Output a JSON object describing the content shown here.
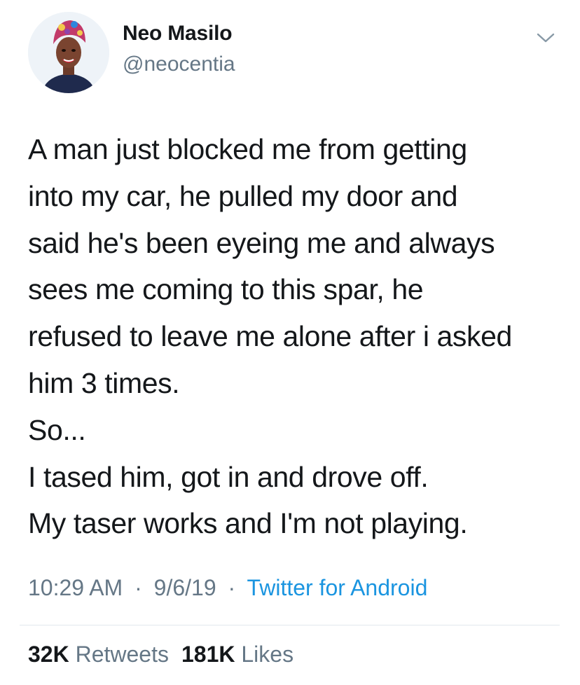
{
  "user": {
    "display_name": "Neo Masilo",
    "handle": "@neocentia"
  },
  "tweet": {
    "lines": [
      "A man just blocked me from getting",
      "into my car, he pulled my door and",
      "said he's been eyeing me and always",
      "sees me coming to this spar, he",
      "refused to leave me alone after i asked",
      "him 3 times.",
      "So...",
      "I tased him, got in and drove off.",
      "My taser works and I'm not playing."
    ]
  },
  "meta": {
    "time": "10:29 AM",
    "date": "9/6/19",
    "separator": "·",
    "source": "Twitter for Android"
  },
  "stats": {
    "retweets_count": "32K",
    "retweets_label": "Retweets",
    "likes_count": "181K",
    "likes_label": "Likes"
  },
  "icons": {
    "menu": "chevron-down-icon"
  },
  "colors": {
    "text": "#14171a",
    "secondary": "#657786",
    "link": "#1b95e0",
    "divider": "#e1e8ed"
  }
}
